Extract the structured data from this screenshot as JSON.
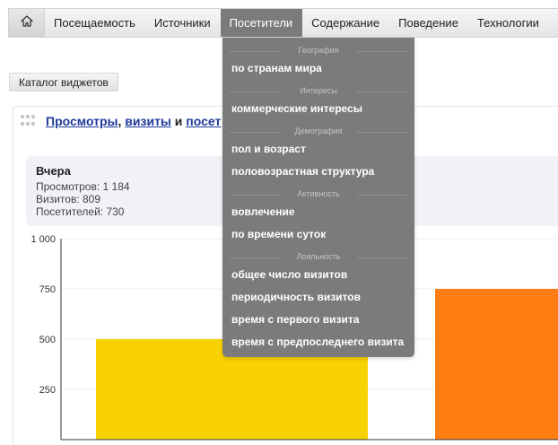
{
  "nav": {
    "home_icon": "home-icon",
    "items": [
      {
        "label": "Посещаемость",
        "active": false
      },
      {
        "label": "Источники",
        "active": false
      },
      {
        "label": "Посетители",
        "active": true
      },
      {
        "label": "Содержание",
        "active": false
      },
      {
        "label": "Поведение",
        "active": false
      },
      {
        "label": "Технологии",
        "active": false
      }
    ]
  },
  "catalog_button": "Каталог виджетов",
  "widget": {
    "title_link1": "Просмотры",
    "title_sep1": ", ",
    "title_link2": "визиты",
    "title_sep2": " и ",
    "title_link3": "посет",
    "summary": {
      "title": "Вчера",
      "views": "Просмотров: 1 184",
      "visits": "Визитов: 809",
      "visitors": "Посетителей: 730"
    }
  },
  "chart_data": {
    "type": "bar",
    "categories": [
      "",
      ""
    ],
    "values": [
      500,
      750
    ],
    "colors": [
      "#f7d100",
      "#ff7d13"
    ],
    "ylim": [
      0,
      1000
    ],
    "yticks": [
      "1 000",
      "750",
      "500",
      "250"
    ]
  },
  "dropdown": {
    "sections": [
      {
        "header": "География",
        "items": [
          "по странам мира"
        ]
      },
      {
        "header": "Интересы",
        "items": [
          "коммерческие интересы"
        ]
      },
      {
        "header": "Демография",
        "items": [
          "пол и возраст",
          "половозрастная структура"
        ]
      },
      {
        "header": "Активность",
        "items": [
          "вовлечение",
          "по времени суток"
        ]
      },
      {
        "header": "Лояльность",
        "items": [
          "общее число визитов",
          "периодичность визитов",
          "время с первого визита",
          "время с предпоследнего визита"
        ]
      }
    ]
  }
}
